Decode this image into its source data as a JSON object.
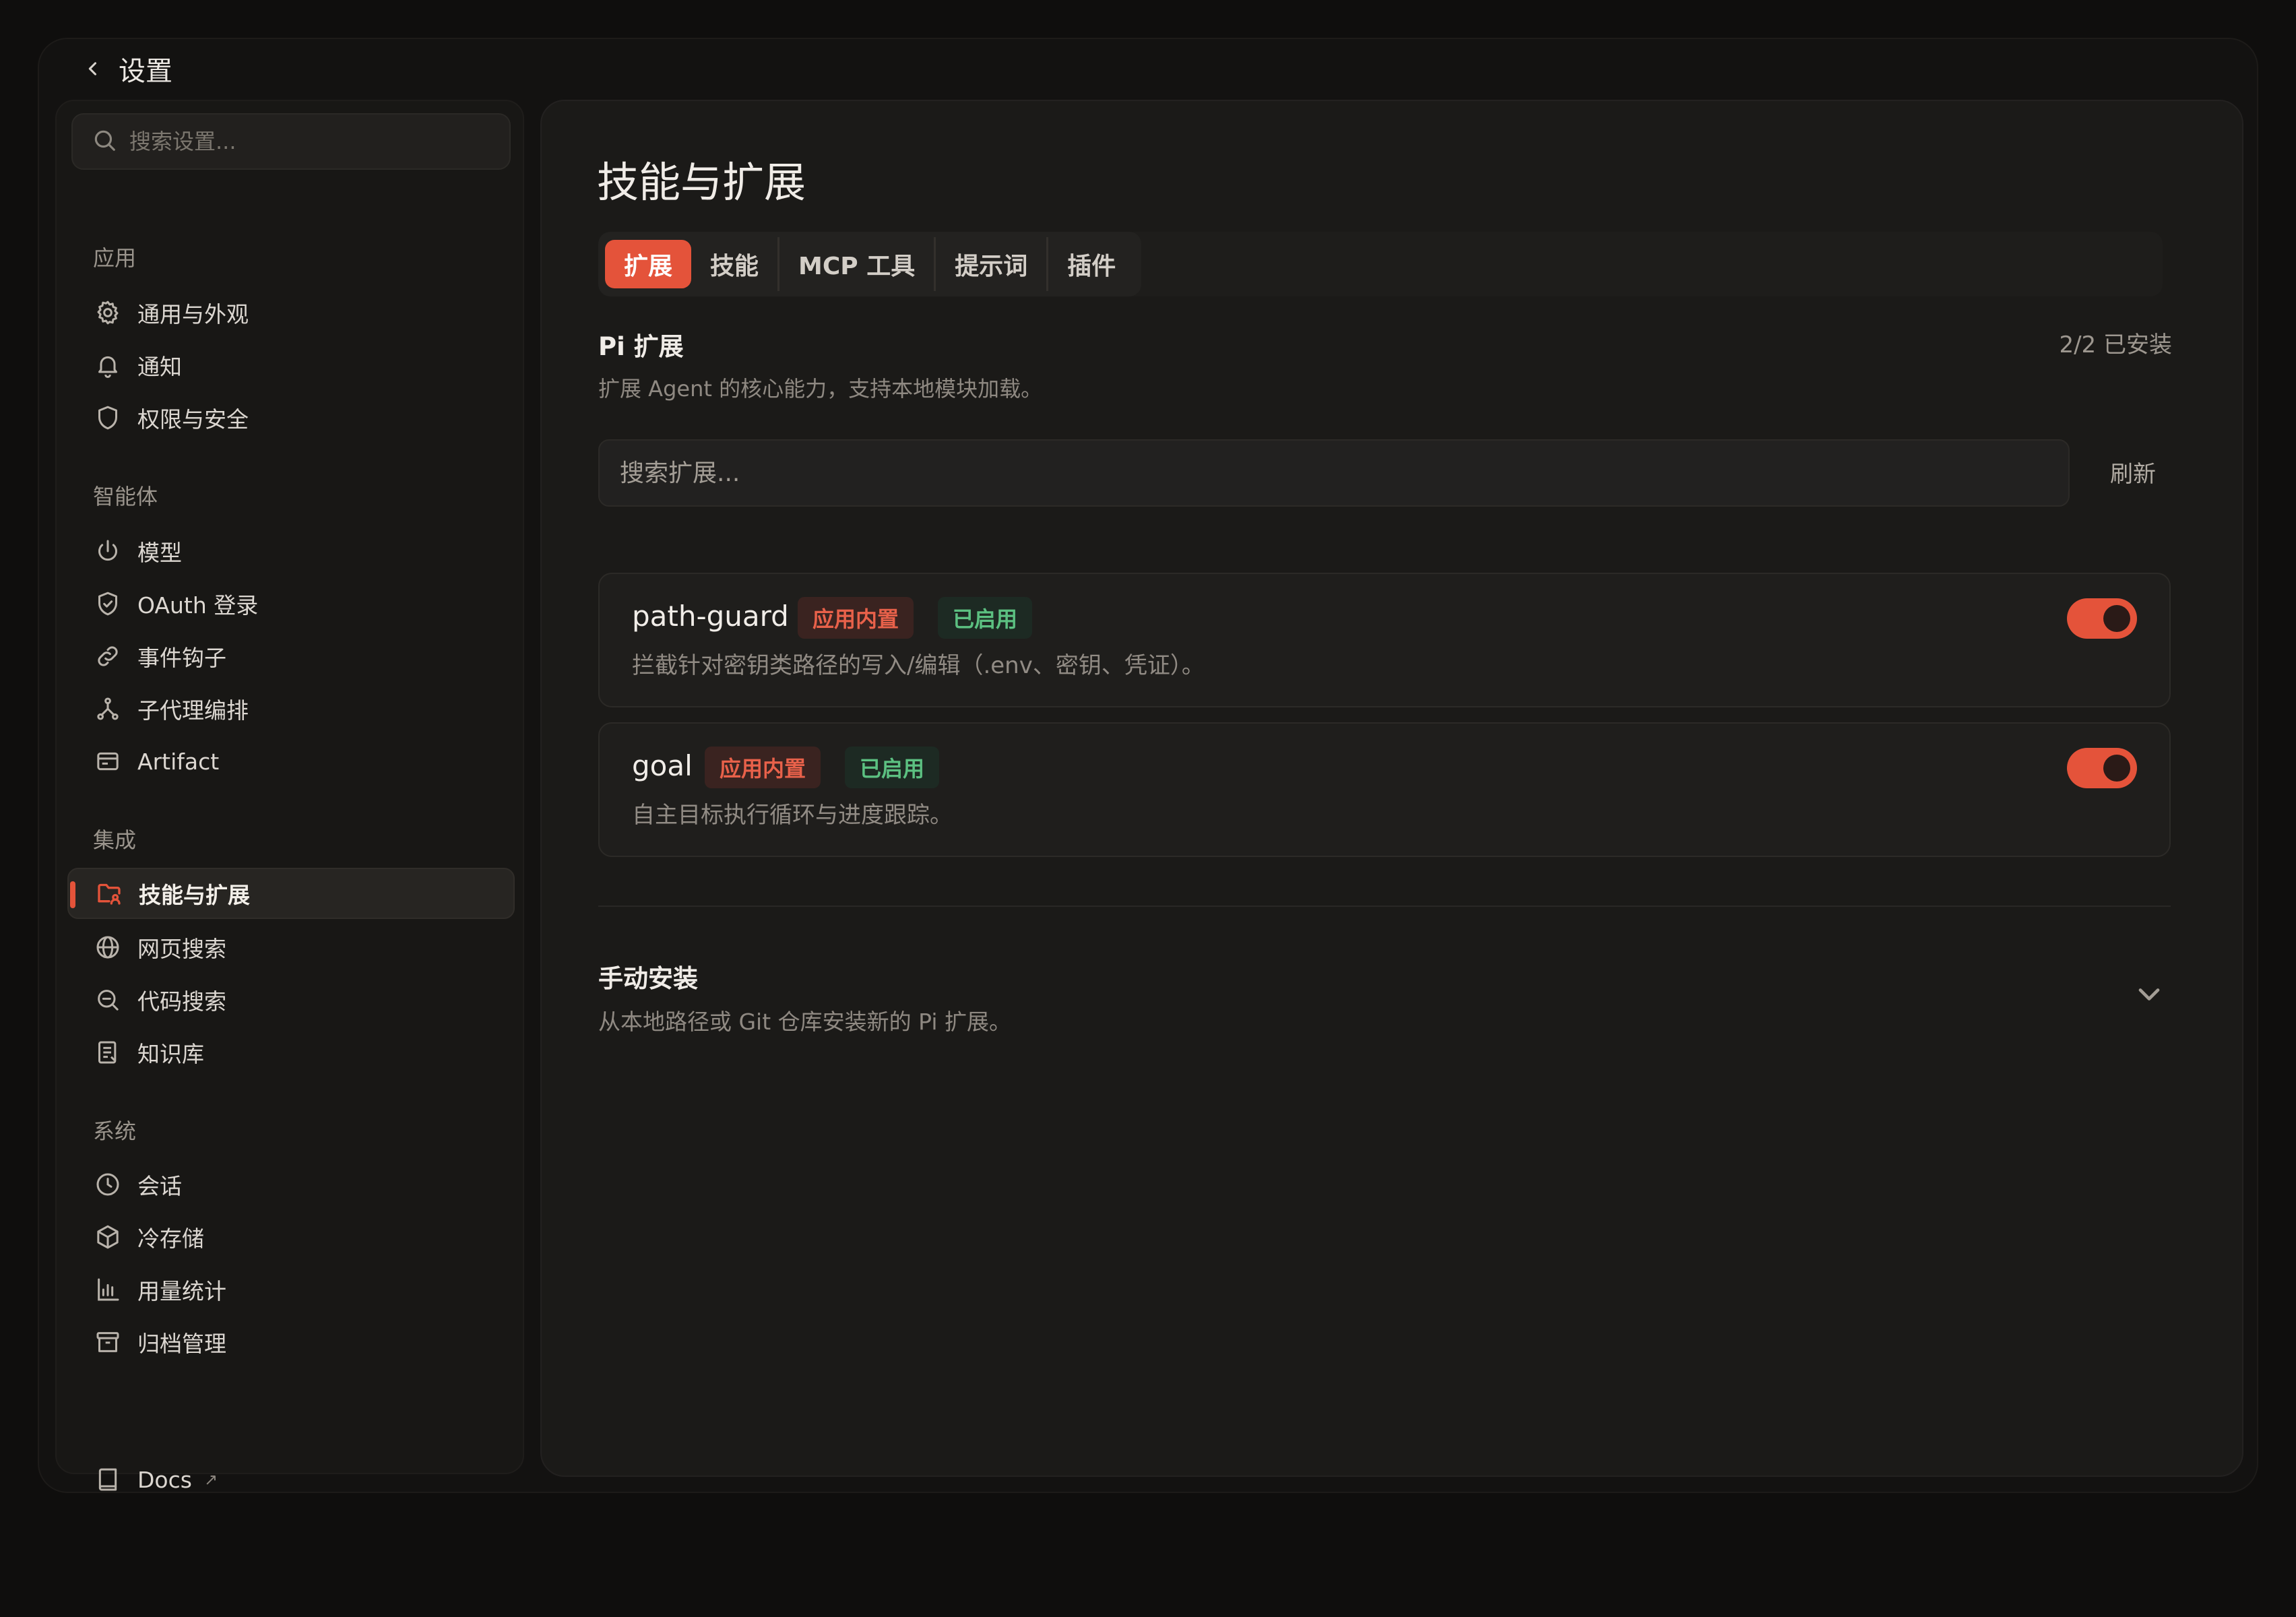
{
  "window": {
    "title": "设置"
  },
  "sidebar": {
    "search_placeholder": "搜索设置...",
    "sections": [
      {
        "title": "应用",
        "items": [
          {
            "label": "通用与外观",
            "icon": "gear-icon"
          },
          {
            "label": "通知",
            "icon": "bell-icon"
          },
          {
            "label": "权限与安全",
            "icon": "shield-icon"
          }
        ]
      },
      {
        "title": "智能体",
        "items": [
          {
            "label": "模型",
            "icon": "power-icon"
          },
          {
            "label": "OAuth 登录",
            "icon": "shield-check-icon"
          },
          {
            "label": "事件钩子",
            "icon": "link-icon"
          },
          {
            "label": "子代理编排",
            "icon": "branch-icon"
          },
          {
            "label": "Artifact",
            "icon": "card-icon"
          }
        ]
      },
      {
        "title": "集成",
        "items": [
          {
            "label": "技能与扩展",
            "icon": "folder-user-icon",
            "active": true
          },
          {
            "label": "网页搜索",
            "icon": "globe-icon"
          },
          {
            "label": "代码搜索",
            "icon": "zoom-out-icon"
          },
          {
            "label": "知识库",
            "icon": "document-icon"
          }
        ]
      },
      {
        "title": "系统",
        "items": [
          {
            "label": "会话",
            "icon": "clock-icon"
          },
          {
            "label": "冷存储",
            "icon": "cube-icon"
          },
          {
            "label": "用量统计",
            "icon": "bar-chart-icon"
          },
          {
            "label": "归档管理",
            "icon": "archive-icon"
          }
        ]
      }
    ],
    "docs": {
      "label": "Docs",
      "icon": "book-icon",
      "external_glyph": "↗"
    }
  },
  "main": {
    "title": "技能与扩展",
    "tabs": [
      {
        "label": "扩展",
        "active": true
      },
      {
        "label": "技能"
      },
      {
        "label": "MCP 工具"
      },
      {
        "label": "提示词"
      },
      {
        "label": "插件"
      }
    ],
    "pi_section": {
      "title": "Pi 扩展",
      "installed_count": "2/2 已安装",
      "description": "扩展 Agent 的核心能力，支持本地模块加载。",
      "search_placeholder": "搜索扩展...",
      "refresh_label": "刷新"
    },
    "extensions": [
      {
        "name": "path-guard",
        "builtin_badge": "应用内置",
        "enabled_badge": "已启用",
        "description": "拦截针对密钥类路径的写入/编辑（.env、密钥、凭证）。",
        "enabled": true
      },
      {
        "name": "goal",
        "builtin_badge": "应用内置",
        "enabled_badge": "已启用",
        "description": "自主目标执行循环与进度跟踪。",
        "enabled": true
      }
    ],
    "manual_install": {
      "title": "手动安装",
      "description": "从本地路径或 Git 仓库安装新的 Pi 扩展。"
    }
  },
  "colors": {
    "accent": "#e4533a",
    "enabled_green": "#5cc081",
    "background": "#131211",
    "panel": "#1b1a18"
  }
}
